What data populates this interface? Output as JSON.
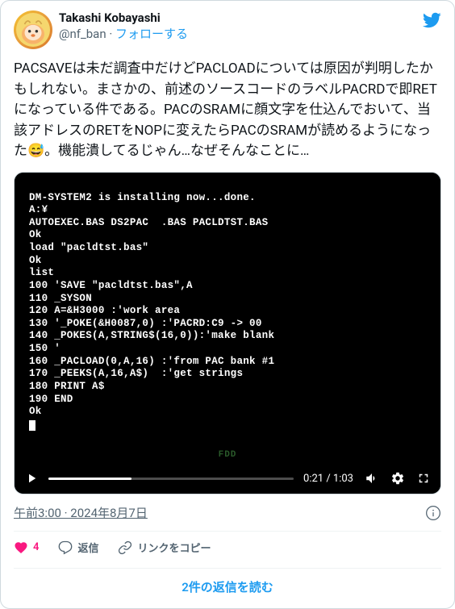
{
  "user": {
    "display_name": "Takashi Kobayashi",
    "handle": "@nf_ban",
    "follow_label": "フォローする"
  },
  "tweet_text": "PACSAVEは未だ調査中だけどPACLOADについては原因が判明したかもしれない。まさかの、前述のソースコードのラベルPACRDで即RETになっている件である。PACのSRAMに顔文字を仕込んでおいて、当該アドレスのRETをNOPに変えたらPACのSRAMが読めるようになった😅。機能潰してるじゃん…なぜそんなことに…",
  "terminal": {
    "lines": [
      "DM-SYSTEM2 is installing now...done.",
      "A:¥",
      "AUTOEXEC.BAS DS2PAC  .BAS PACLDTST.BAS",
      "Ok",
      "load \"pacldtst.bas\"",
      "Ok",
      "list",
      "100 'SAVE \"pacldtst.bas\",A",
      "110 _SYSON",
      "120 A=&H3000 :'work area",
      "130 '_POKE(&H0087,0) :'PACRD:C9 -> 00",
      "140 _POKES(A,STRING$(16,0)):'make blank",
      "150 '",
      "160 _PACLOAD(0,A,16) :'from PAC bank #1",
      "170 _PEEKS(A,16,A$)  :'get strings",
      "180 PRINT A$",
      "190 END",
      "Ok"
    ],
    "fdd_label": "FDD"
  },
  "video": {
    "current_time": "0:21",
    "duration": "1:03"
  },
  "meta": {
    "timestamp": "午前3:00 · 2024年8月7日"
  },
  "actions": {
    "like_count": "4",
    "reply_label": "返信",
    "copy_link_label": "リンクをコピー"
  },
  "replies": {
    "read_label": "2件の返信を読む"
  }
}
